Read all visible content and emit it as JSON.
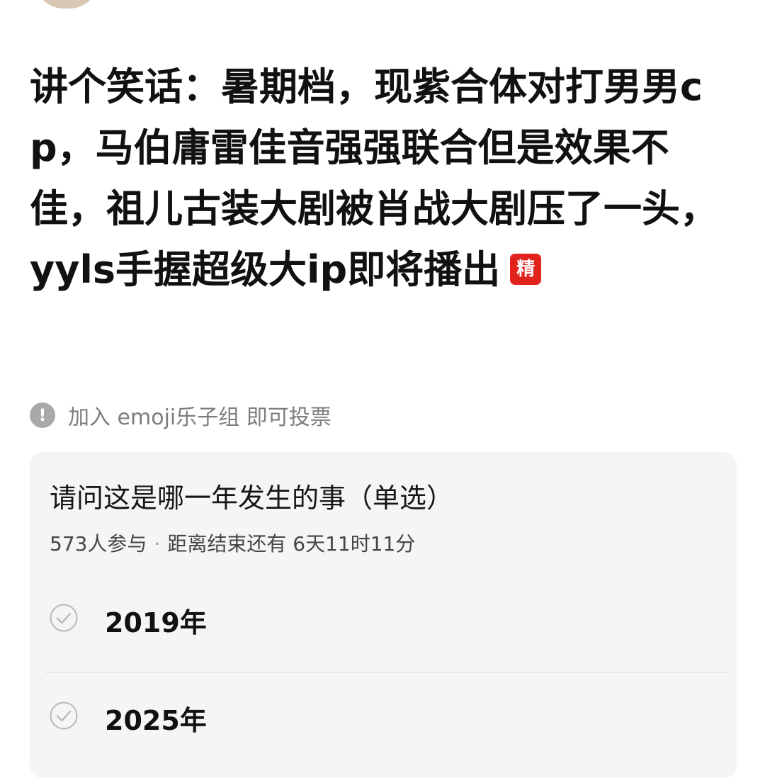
{
  "post": {
    "title": "讲个笑话：暑期档，现紫合体对打男男cp，马伯庸雷佳音强强联合但是效果不佳，祖儿古装大剧被肖战大剧压了一头，yyls手握超级大ip即将播出",
    "essence_badge": "精"
  },
  "notice": {
    "icon_glyph": "!",
    "text": "加入 emoji乐子组 即可投票"
  },
  "poll": {
    "question": "请问这是哪一年发生的事（单选）",
    "participants": "573人参与",
    "separator": "·",
    "remaining": "距离结束还有 6天11时11分",
    "options": [
      {
        "label": "2019年"
      },
      {
        "label": "2025年"
      }
    ]
  },
  "colors": {
    "badge_red": "#e0231c",
    "card_bg": "#f5f5f5",
    "muted_text": "#7d7d7d"
  }
}
